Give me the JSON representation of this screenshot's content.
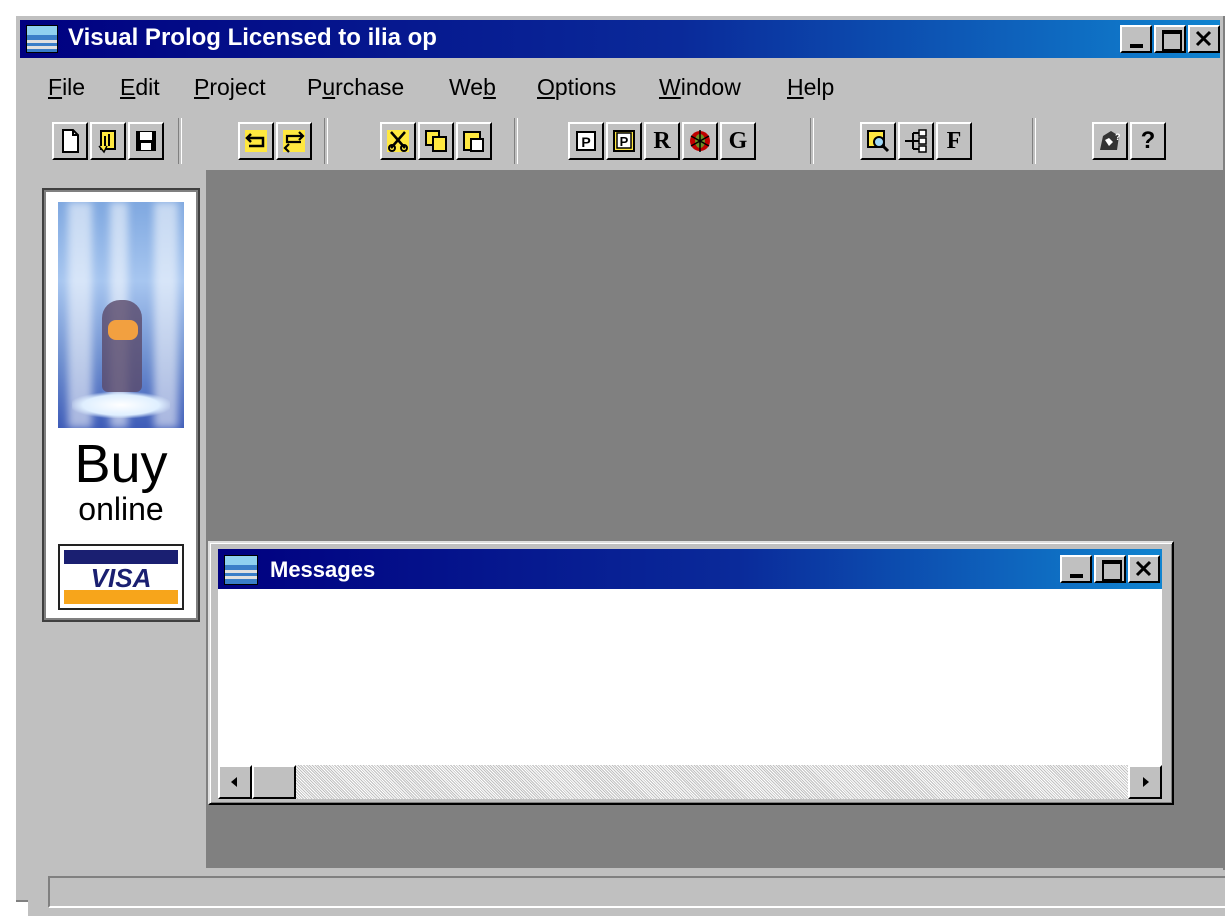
{
  "window": {
    "title": "Visual Prolog Licensed to ilia op",
    "controls": [
      "minimize",
      "maximize",
      "close"
    ]
  },
  "menu": [
    {
      "label": "File",
      "underline": "F"
    },
    {
      "label": "Edit",
      "underline": "E"
    },
    {
      "label": "Project",
      "underline": "P"
    },
    {
      "label": "Purchase",
      "underline": "u"
    },
    {
      "label": "Web",
      "underline": "b"
    },
    {
      "label": "Options",
      "underline": "O"
    },
    {
      "label": "Window",
      "underline": "W"
    },
    {
      "label": "Help",
      "underline": "H"
    }
  ],
  "toolbar": {
    "buttons": [
      {
        "icon": "new-file-icon",
        "group": 1
      },
      {
        "icon": "open-file-icon",
        "group": 1
      },
      {
        "icon": "save-icon",
        "group": 1
      },
      {
        "icon": "undo-icon",
        "group": 2
      },
      {
        "icon": "redo-icon",
        "group": 2
      },
      {
        "icon": "cut-icon",
        "group": 3
      },
      {
        "icon": "copy-icon",
        "group": 3
      },
      {
        "icon": "paste-icon",
        "group": 3
      },
      {
        "icon": "project-icon",
        "group": 4,
        "label": "P"
      },
      {
        "icon": "project-file-icon",
        "group": 4,
        "label": "P"
      },
      {
        "icon": "run-icon",
        "group": 4,
        "label": "R"
      },
      {
        "icon": "debug-icon",
        "group": 4
      },
      {
        "icon": "go-icon",
        "group": 4,
        "label": "G"
      },
      {
        "icon": "browse-icon",
        "group": 5
      },
      {
        "icon": "tree-icon",
        "group": 5
      },
      {
        "icon": "find-icon",
        "group": 5,
        "label": "F"
      },
      {
        "icon": "help-topics-icon",
        "group": 6
      },
      {
        "icon": "help-icon",
        "group": 6,
        "label": "?"
      }
    ]
  },
  "ad": {
    "buy": "Buy",
    "online": "online",
    "card": "VISA"
  },
  "messages_window": {
    "title": "Messages",
    "content": ""
  },
  "status": {
    "text": ""
  }
}
